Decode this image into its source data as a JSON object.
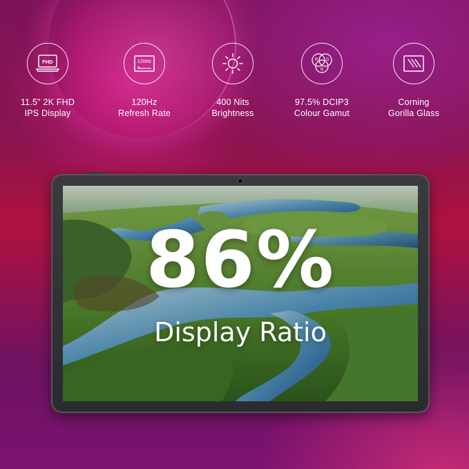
{
  "features": [
    {
      "icon": "fhd-laptop-icon",
      "badge": "FHD",
      "line1": "11.5\" 2K FHD",
      "line2": "IPS Display"
    },
    {
      "icon": "refresh-rate-icon",
      "badge": "120Hz",
      "line1": "120Hz",
      "line2": "Refresh Rate"
    },
    {
      "icon": "sun-brightness-icon",
      "badge": "",
      "line1": "400 Nits",
      "line2": "Brightness"
    },
    {
      "icon": "rgb-gamut-icon",
      "badge": "",
      "rgb": [
        "R",
        "G",
        "B"
      ],
      "line1": "97.5% DCIP3",
      "line2": "Colour Gamut"
    },
    {
      "icon": "glass-screen-icon",
      "badge": "",
      "line1": "Corning",
      "line2": "Gorilla Glass"
    }
  ],
  "hero": {
    "percent": "86%",
    "label": "Display Ratio"
  },
  "colors": {
    "text": "#ffffff",
    "bg_top": "#7c1458",
    "bg_mid": "#b0123f",
    "bg_bottom": "#7b1370",
    "tablet_frame": "#2f3034"
  }
}
